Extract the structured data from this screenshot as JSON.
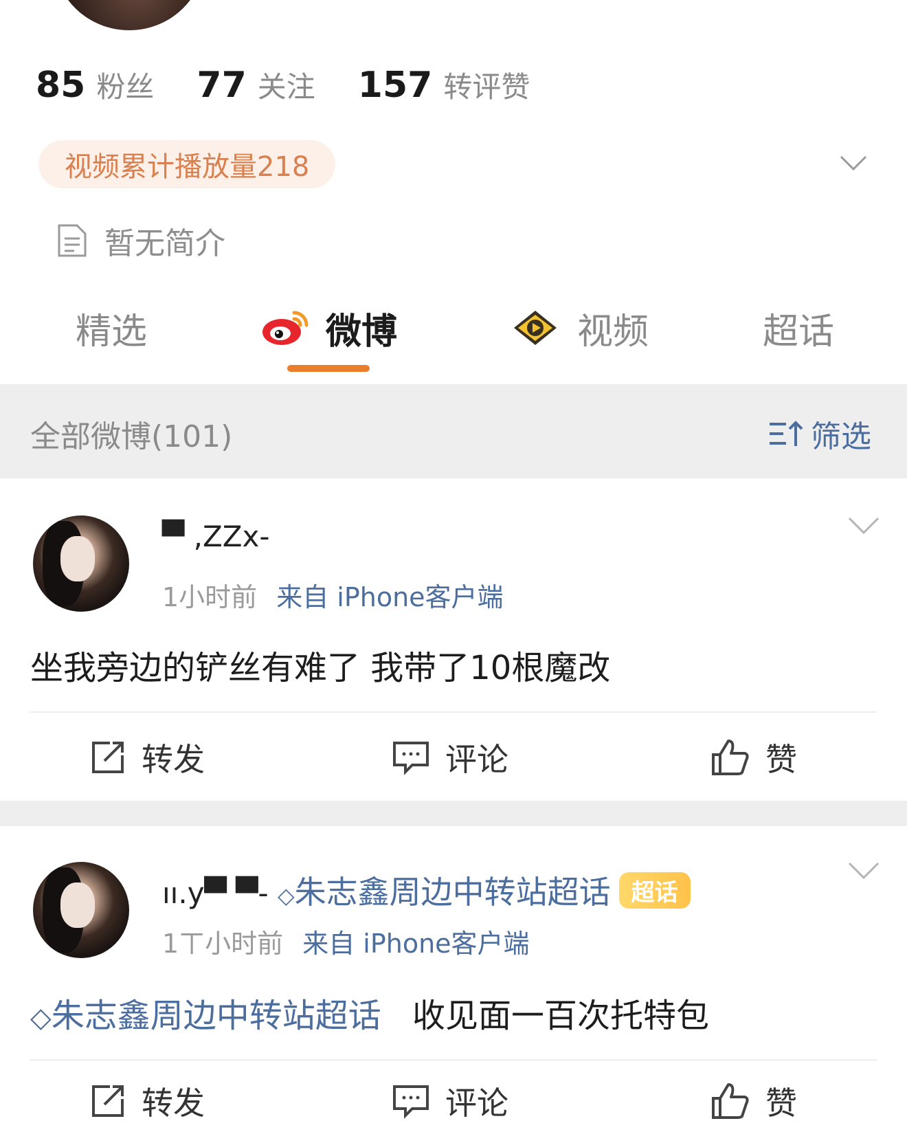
{
  "profile": {
    "stats": [
      {
        "num": "85",
        "label": "粉丝"
      },
      {
        "num": "77",
        "label": "关注"
      },
      {
        "num": "157",
        "label": "转评赞"
      }
    ],
    "video_plays": "视频累计播放量218",
    "bio": "暂无简介"
  },
  "tabs": [
    {
      "label": "精选"
    },
    {
      "label": "微博"
    },
    {
      "label": "视频"
    },
    {
      "label": "超话"
    }
  ],
  "filter_bar": {
    "count_label": "全部微博(101)",
    "filter_label": "筛选"
  },
  "posts": [
    {
      "username": "▀ ,ZZx-",
      "time": "1小时前",
      "source": "来自 iPhone客户端",
      "text": "坐我旁边的铲丝有难了 我带了10根魔改",
      "actions": {
        "repost": "转发",
        "comment": "评论",
        "like": "赞"
      }
    },
    {
      "username": "ıı.y▀ ▀-",
      "topic": "朱志鑫周边中转站超话",
      "badge": "超话",
      "time": "1ㄒ小时前",
      "source": "来自 iPhone客户端",
      "text_topic": "朱志鑫周边中转站超话",
      "text": "收见面一百次托特包",
      "actions": {
        "repost": "转发",
        "comment": "评论",
        "like": "赞"
      }
    }
  ],
  "colors": {
    "accent_orange": "#ea7e2c",
    "link_blue": "#4c6e9e",
    "pill_bg": "#fdf0e9",
    "pill_text": "#d9804e"
  }
}
